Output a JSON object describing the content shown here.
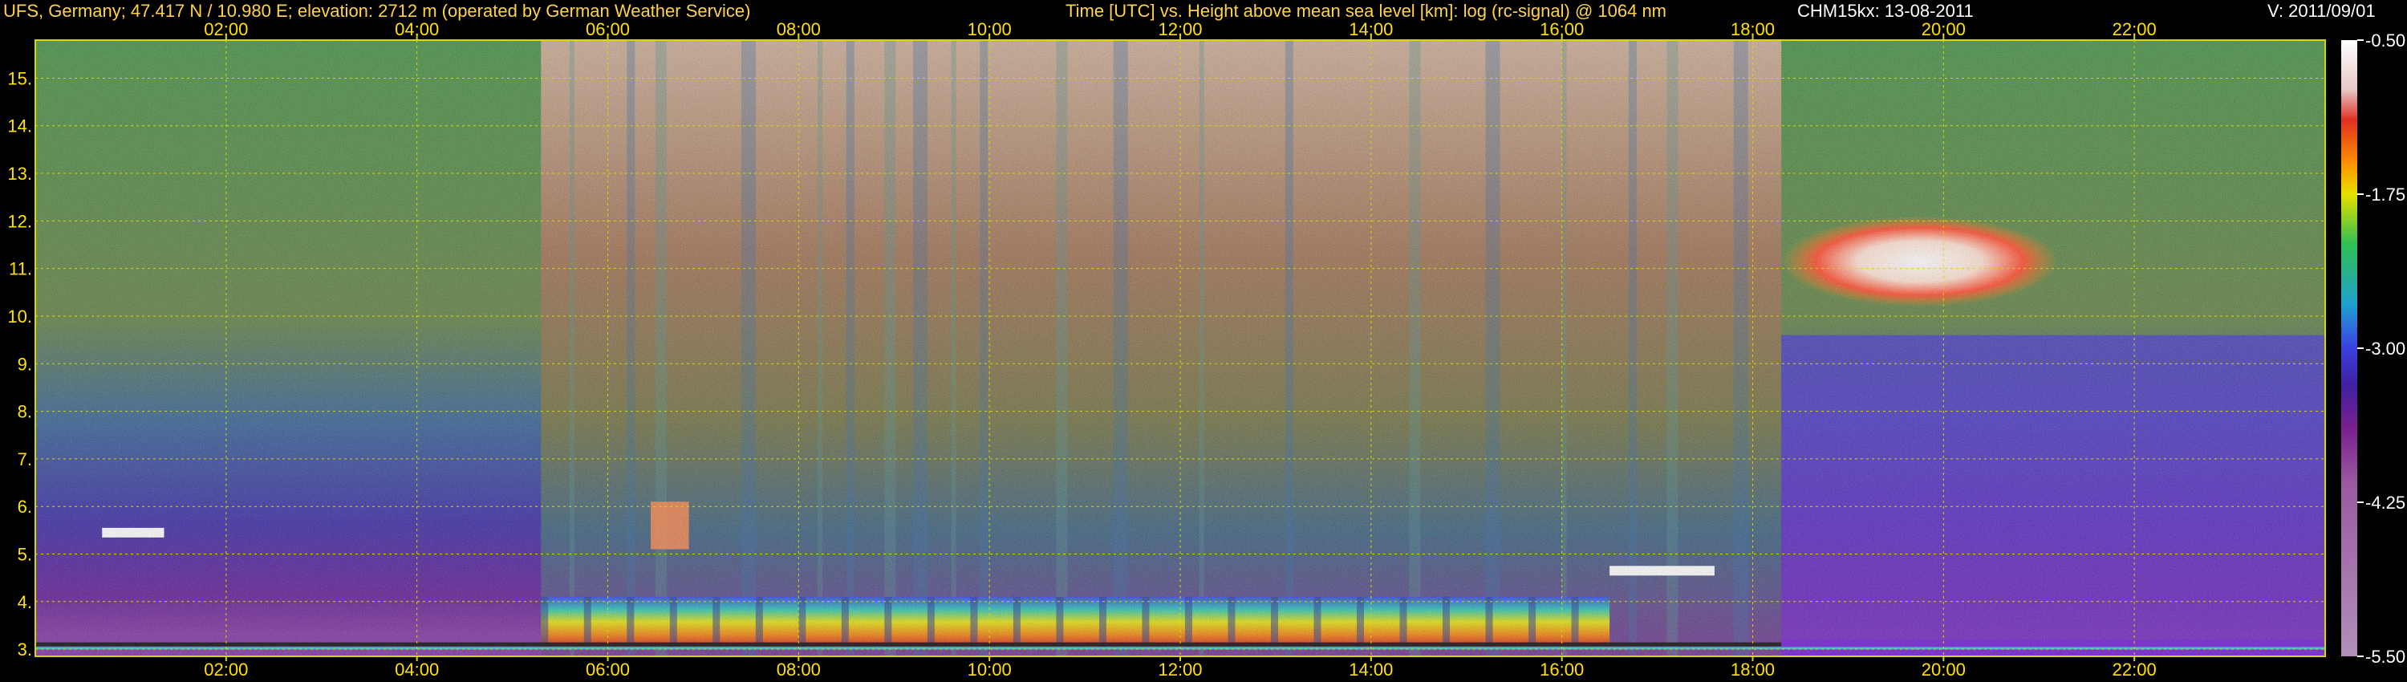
{
  "header": {
    "station": "UFS, Germany; 47.417 N / 10.980 E; elevation: 2712 m  (operated by German Weather Service)",
    "axes_title": "Time [UTC] vs. Height above mean sea level [km]: log (rc-signal) @ 1064 nm",
    "instrument": "CHM15kx: 13-08-2011",
    "version": "V: 2011/09/01"
  },
  "colors": {
    "header_left": "#ffd24a",
    "header_right": "#ffffff",
    "tick_label": "#ffe000",
    "grid": "#d8d800"
  },
  "chart_data": {
    "type": "heatmap",
    "title": "Time [UTC] vs. Height above mean sea level [km]: log (rc-signal) @ 1064 nm",
    "xlabel": "Time [UTC]",
    "ylabel": "Height above mean sea level [km]",
    "x_range_hours": [
      0,
      24
    ],
    "y_range_km": [
      2.85,
      15.8
    ],
    "x_ticks": [
      "02:00",
      "04:00",
      "06:00",
      "08:00",
      "10:00",
      "12:00",
      "14:00",
      "16:00",
      "18:00",
      "20:00",
      "22:00"
    ],
    "x_tick_hours": [
      2,
      4,
      6,
      8,
      10,
      12,
      14,
      16,
      18,
      20,
      22
    ],
    "y_ticks": [
      "3.",
      "4.",
      "5.",
      "6.",
      "7.",
      "8.",
      "9.",
      "10.",
      "11.",
      "12.",
      "13.",
      "14.",
      "15."
    ],
    "y_tick_km": [
      3,
      4,
      5,
      6,
      7,
      8,
      9,
      10,
      11,
      12,
      13,
      14,
      15
    ],
    "grid": true,
    "colorbar": {
      "labels": [
        "-0.50",
        "-1.75",
        "-3.00",
        "-4.25",
        "-5.50"
      ],
      "values": [
        -0.5,
        -1.75,
        -3.0,
        -4.25,
        -5.5
      ],
      "range": [
        -5.5,
        -0.5
      ]
    },
    "features": {
      "cirrus_cloud": {
        "start_h": 18.3,
        "end_h": 21.2,
        "base_km": 10.2,
        "top_km": 12.1
      },
      "boundary_layer": {
        "start_h": 5.3,
        "end_h": 16.5,
        "top_km": 4.1
      },
      "elevated_layer": {
        "start_h": 16.5,
        "end_h": 17.6,
        "height_km": 4.6
      },
      "low_cloud": {
        "start_h": 6.45,
        "end_h": 6.85,
        "base_km": 5.1,
        "top_km": 6.1
      },
      "early_cloud": {
        "start_h": 0.7,
        "end_h": 1.35,
        "height_km": 5.4
      }
    }
  }
}
